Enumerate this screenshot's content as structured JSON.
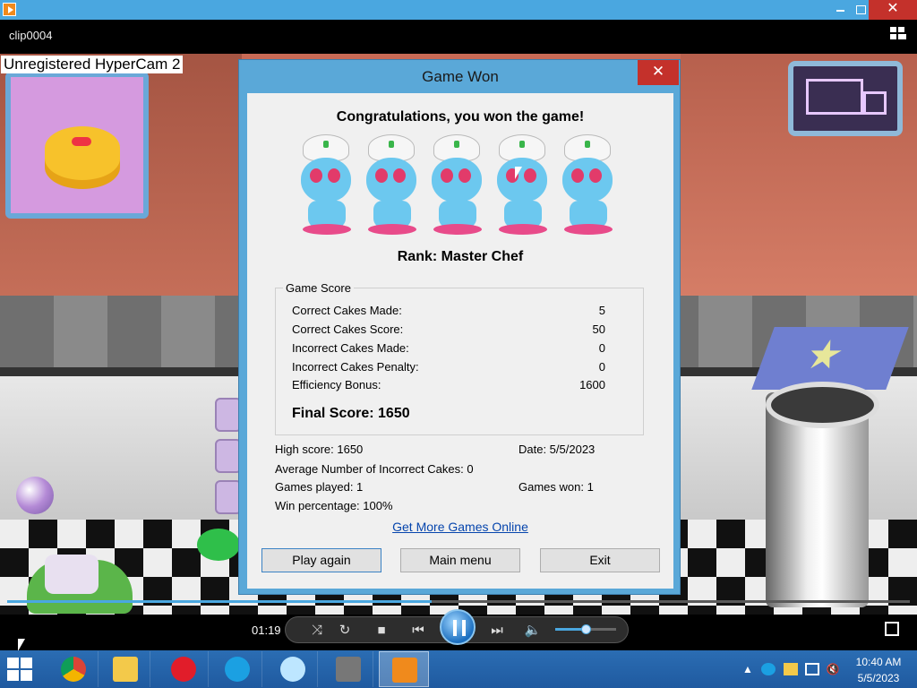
{
  "window": {
    "title": "clip0004",
    "watermark": "Unregistered HyperCam 2",
    "minimize_icon": "minimize-icon",
    "maximize_icon": "maximize-icon",
    "close_symbol": "✕"
  },
  "dialog": {
    "title": "Game Won",
    "close_symbol": "✕",
    "congrats": "Congratulations, you won the game!",
    "rank": "Rank: Master Chef",
    "chef_count": 5,
    "score_group_label": "Game Score",
    "score_rows": [
      {
        "label": "Correct Cakes Made:",
        "value": "5"
      },
      {
        "label": "Correct Cakes Score:",
        "value": "50"
      },
      {
        "label": "Incorrect Cakes Made:",
        "value": "0"
      },
      {
        "label": "Incorrect Cakes Penalty:",
        "value": "0"
      },
      {
        "label": "Efficiency Bonus:",
        "value": "1600"
      }
    ],
    "final_score": "Final Score: 1650",
    "stats": {
      "high_score": "High score: 1650",
      "date": "Date: 5/5/2023",
      "avg_incorrect": "Average Number of Incorrect Cakes: 0",
      "games_played": "Games played: 1",
      "games_won": "Games won: 1",
      "win_percentage": "Win percentage: 100%"
    },
    "link": "Get More Games Online",
    "buttons": {
      "play_again": "Play again",
      "main_menu": "Main menu",
      "exit": "Exit"
    }
  },
  "player": {
    "time": "01:19",
    "progress": 0.47,
    "volume": 0.5,
    "icons": [
      "shuffle-icon",
      "repeat-icon",
      "stop-icon",
      "previous-icon",
      "pause-icon",
      "next-icon",
      "volume-icon",
      "fullscreen-icon"
    ]
  },
  "taskbar": {
    "apps": [
      "chrome-icon",
      "file-explorer-icon",
      "opera-icon",
      "skype-icon",
      "eyes-app-icon",
      "game-app-icon",
      "media-player-icon"
    ],
    "clock_time": "10:40 AM",
    "clock_date": "5/5/2023",
    "tray_icons": [
      "show-hidden-icons",
      "skype-tray-icon",
      "action-center-icon",
      "network-icon",
      "volume-muted-icon"
    ]
  },
  "colors": {
    "title_blue": "#4aa7e0",
    "close_red": "#c4312b",
    "dialog_bg": "#f0f0f0",
    "link_blue": "#0645ad",
    "taskbar_blue": "#2b6db3"
  }
}
